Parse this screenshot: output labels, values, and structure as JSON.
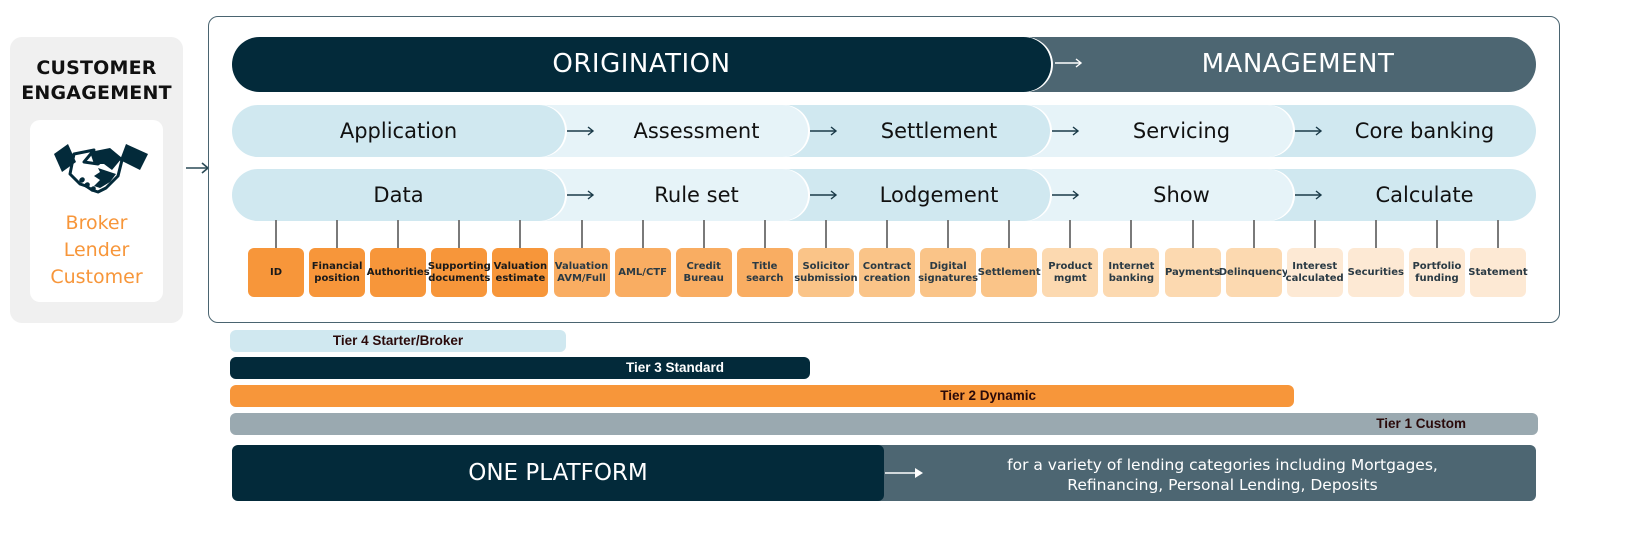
{
  "customer_engagement": {
    "title_line1": "CUSTOMER",
    "title_line2": "ENGAGEMENT",
    "icon": "handshake-icon",
    "roles": [
      "Broker",
      "Lender",
      "Customer"
    ],
    "role_color": "#f7963a"
  },
  "header": {
    "origination": "ORIGINATION",
    "management": "MANAGEMENT",
    "colors": {
      "origination": "#032a3a",
      "management": "#4d6672"
    }
  },
  "stages": {
    "row1": [
      "Application",
      "Assessment",
      "Settlement",
      "Servicing",
      "Core banking"
    ],
    "row2": [
      "Data",
      "Rule set",
      "Lodgement",
      "Show",
      "Calculate"
    ]
  },
  "functions": [
    {
      "label": "ID",
      "color": "#f7963a"
    },
    {
      "label": "Financial position",
      "color": "#f7963a"
    },
    {
      "label": "Authorities",
      "color": "#f7963a"
    },
    {
      "label": "Supporting documents",
      "color": "#f7963a"
    },
    {
      "label": "Valuation estimate",
      "color": "#f7963a"
    },
    {
      "label": "Valuation AVM/Full",
      "color": "#f9ad62"
    },
    {
      "label": "AML/CTF",
      "color": "#f9ad62"
    },
    {
      "label": "Credit Bureau",
      "color": "#f9ad62"
    },
    {
      "label": "Title search",
      "color": "#f9ad62"
    },
    {
      "label": "Solicitor submission",
      "color": "#fac488"
    },
    {
      "label": "Contract creation",
      "color": "#fac488"
    },
    {
      "label": "Digital signatures",
      "color": "#fac488"
    },
    {
      "label": "Settlement",
      "color": "#fac488"
    },
    {
      "label": "Product mgmt",
      "color": "#fcd9b0"
    },
    {
      "label": "Internet banking",
      "color": "#fcd9b0"
    },
    {
      "label": "Payments",
      "color": "#fcd9b0"
    },
    {
      "label": "Delinquency",
      "color": "#fcd9b0"
    },
    {
      "label": "Interest calculated",
      "color": "#fde9d4"
    },
    {
      "label": "Securities",
      "color": "#fde9d4"
    },
    {
      "label": "Portfolio funding",
      "color": "#fde9d4"
    },
    {
      "label": "Statement",
      "color": "#fde9d4"
    }
  ],
  "tiers": [
    {
      "label": "Tier 4 Starter/Broker",
      "color": "#d0e8f0",
      "text_color": "#2a0a0a"
    },
    {
      "label": "Tier 3 Standard",
      "color": "#032a3a",
      "text_color": "#ffffff"
    },
    {
      "label": "Tier 2 Dynamic",
      "color": "#f7963a",
      "text_color": "#2a0a0a"
    },
    {
      "label": "Tier 1 Custom",
      "color": "#9aa9b0",
      "text_color": "#2a0a0a"
    }
  ],
  "platform": {
    "title": "ONE PLATFORM",
    "description_line1": "for a variety of lending categories including Mortgages,",
    "description_line2": "Refinancing, Personal Lending, Deposits"
  }
}
